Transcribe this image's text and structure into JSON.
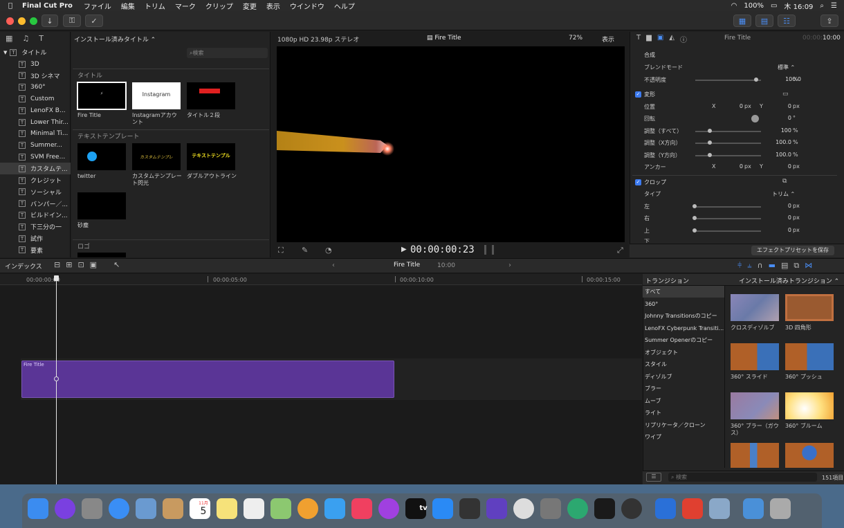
{
  "menubar": {
    "apple": "",
    "app_name": "Final Cut Pro",
    "items": [
      "ファイル",
      "編集",
      "トリム",
      "マーク",
      "クリップ",
      "変更",
      "表示",
      "ウインドウ",
      "ヘルプ"
    ],
    "battery": "100%",
    "clock": "木 16:09"
  },
  "sidebar": {
    "root_label": "タイトル",
    "items": [
      "3D",
      "3D シネマ",
      "360°",
      "Custom",
      "LenoFX B...",
      "Lower Thir...",
      "Minimal Ti...",
      "Summer...",
      "SVM Free...",
      "カスタムテ...",
      "クレジット",
      "ソーシャル",
      "バンパー／...",
      "ビルドイン...",
      "下三分の一",
      "試作",
      "要素"
    ],
    "selected_index": 9
  },
  "browser": {
    "dropdown_label": "インストール済みタイトル ⌃",
    "search_placeholder": "検索",
    "sections": [
      {
        "title": "タイトル",
        "items": [
          "Fire Title",
          "Instagramアカウント",
          "タイトル２段"
        ]
      },
      {
        "title": "テキストテンプレート",
        "items": [
          "twitter",
          "カスタムテンプレート閃光",
          "ダブルアウトライン",
          "砂塵"
        ]
      },
      {
        "title": "ロゴ",
        "items": []
      }
    ],
    "thumb_texts": {
      "instagram": "Instagram",
      "tt_sub1": "カスタムテンプレ",
      "tt_sub2": "テキストテンプル"
    }
  },
  "viewer": {
    "format": "1080p HD 23.98p ステレオ",
    "clip_title": "Fire Title",
    "zoom": "72%",
    "view_menu": "表示",
    "timecode": "00:00:00:23"
  },
  "inspector": {
    "title": "Fire Title",
    "duration_dim": "00:00:",
    "duration": "10:00",
    "compositing_label": "合成",
    "blend_mode_label": "ブレンドモード",
    "blend_mode_value": "標準 ⌃",
    "opacity_label": "不透明度",
    "opacity_value": "100.0",
    "pct": "%",
    "transform_label": "変形",
    "position_label": "位置",
    "x": "X",
    "y": "Y",
    "px": "px",
    "zero": "0",
    "rotation_label": "回転",
    "deg": "°",
    "scale_all_label": "調整（すべて）",
    "scale_all_value": "100",
    "scale_x_label": "調整（X方向）",
    "scale_x_value": "100.0",
    "scale_y_label": "調整（Y方向）",
    "scale_y_value": "100.0",
    "anchor_label": "アンカー",
    "crop_label": "クロップ",
    "type_label": "タイプ",
    "type_value": "トリム ⌃",
    "left_label": "左",
    "right_label": "右",
    "top_label": "上",
    "bottom_label": "下",
    "save_preset_button": "エフェクトプリセットを保存"
  },
  "timeline_bar": {
    "index_label": "インデックス",
    "project_name": "Fire Title",
    "project_duration": "10:00"
  },
  "ruler": [
    "00:00:00:00",
    "00:00:05:00",
    "00:00:10:00",
    "00:00:15:00"
  ],
  "clip": {
    "name": "Fire Title"
  },
  "transitions": {
    "header_left": "トランジション",
    "header_right": "インストール済みトランジション ⌃",
    "categories": [
      "すべて",
      "360°",
      "Johnny Transitionsのコピー",
      "LenoFX Cyberpunk Transiti...",
      "Summer Openerのコピー",
      "オブジェクト",
      "スタイル",
      "ディゾルブ",
      "ブラー",
      "ムーブ",
      "ライト",
      "リプリケータ／クローン",
      "ワイプ"
    ],
    "selected_index": 0,
    "items": [
      "クロスディゾルブ",
      "3D 四角形",
      "360° スライド",
      "360° プッシュ",
      "360° ブラー（ガウス）",
      "360° ブルーム"
    ],
    "search_placeholder": "検索",
    "count": "151項目"
  },
  "dock": {
    "apps": [
      "finder",
      "siri",
      "launchpad",
      "safari",
      "mail",
      "contacts",
      "calendar",
      "notes",
      "reminders",
      "maps",
      "photos",
      "messages",
      "music",
      "podcasts",
      "apple-tv",
      "app-store",
      "final-cut-pro",
      "motion",
      "chrome",
      "system-preferences",
      "atom",
      "kindle",
      "quicktime",
      "bluetooth",
      "istat",
      "preview",
      "downloads",
      "trash"
    ],
    "calendar_month": "11月",
    "calendar_day": "5",
    "tv_label": "tv"
  }
}
